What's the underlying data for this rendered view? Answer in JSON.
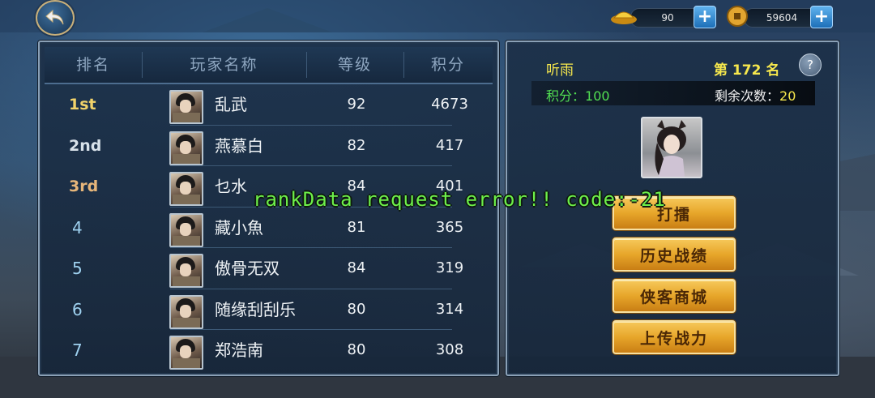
{
  "currencies": [
    {
      "icon": "gold-ingot-icon",
      "value": "90"
    },
    {
      "icon": "copper-coin-icon",
      "value": "59604"
    }
  ],
  "leaderboard": {
    "headers": [
      "排名",
      "玩家名称",
      "等级",
      "积分"
    ],
    "rows": [
      {
        "rank": "1st",
        "name": "乱武",
        "level": "92",
        "score": "4673"
      },
      {
        "rank": "2nd",
        "name": "燕慕白",
        "level": "82",
        "score": "417"
      },
      {
        "rank": "3rd",
        "name": "乜水",
        "level": "84",
        "score": "401"
      },
      {
        "rank": "4",
        "name": "藏小魚",
        "level": "81",
        "score": "365"
      },
      {
        "rank": "5",
        "name": "傲骨无双",
        "level": "84",
        "score": "319"
      },
      {
        "rank": "6",
        "name": "随缘刮刮乐",
        "level": "80",
        "score": "314"
      },
      {
        "rank": "7",
        "name": "郑浩南",
        "level": "80",
        "score": "308"
      }
    ]
  },
  "self": {
    "name": "听雨",
    "rank_text": "第 172 名",
    "score_label": "积分：",
    "score_value": "100",
    "remain_label": "剩余次数：",
    "remain_value": "20",
    "help": "?"
  },
  "actions": {
    "challenge": "打擂",
    "history": "历史战绩",
    "shop": "侠客商城",
    "upload": "上传战力"
  },
  "error_message": "rankData request error!! code:-21",
  "colors": {
    "accent_gold": "#f7e84d",
    "score_green": "#52e052",
    "error_green": "#6df04a"
  }
}
